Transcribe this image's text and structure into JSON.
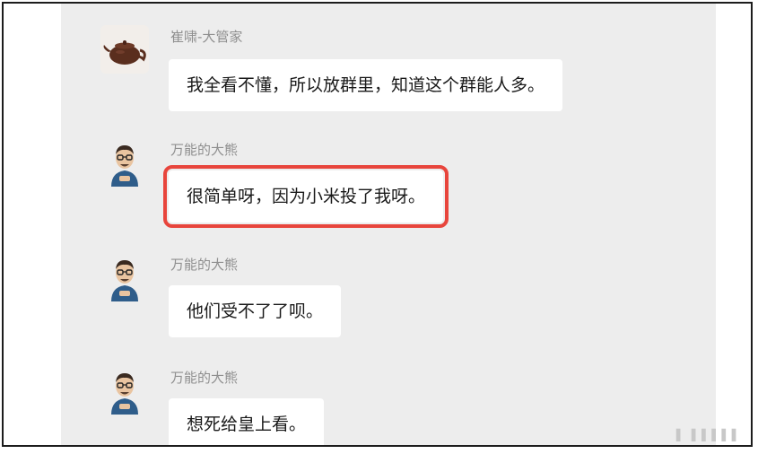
{
  "messages": [
    {
      "sender": "崔啸-大管家",
      "text": "我全看不懂，所以放群里，知道这个群能人多。",
      "avatar_icon": "teapot-avatar-icon"
    },
    {
      "sender": "万能的大熊",
      "text": "很简单呀，因为小米投了我呀。",
      "avatar_icon": "cartoon-man-avatar-icon",
      "highlighted": true
    },
    {
      "sender": "万能的大熊",
      "text": "他们受不了了呗。",
      "avatar_icon": "cartoon-man-avatar-icon"
    },
    {
      "sender": "万能的大熊",
      "text": "想死给皇上看。",
      "avatar_icon": "cartoon-man-avatar-icon"
    }
  ],
  "colors": {
    "chat_bg": "#ededed",
    "bubble_bg": "#ffffff",
    "highlight": "#e8453c"
  },
  "watermark": "▌ ▌▌▌▌▌"
}
